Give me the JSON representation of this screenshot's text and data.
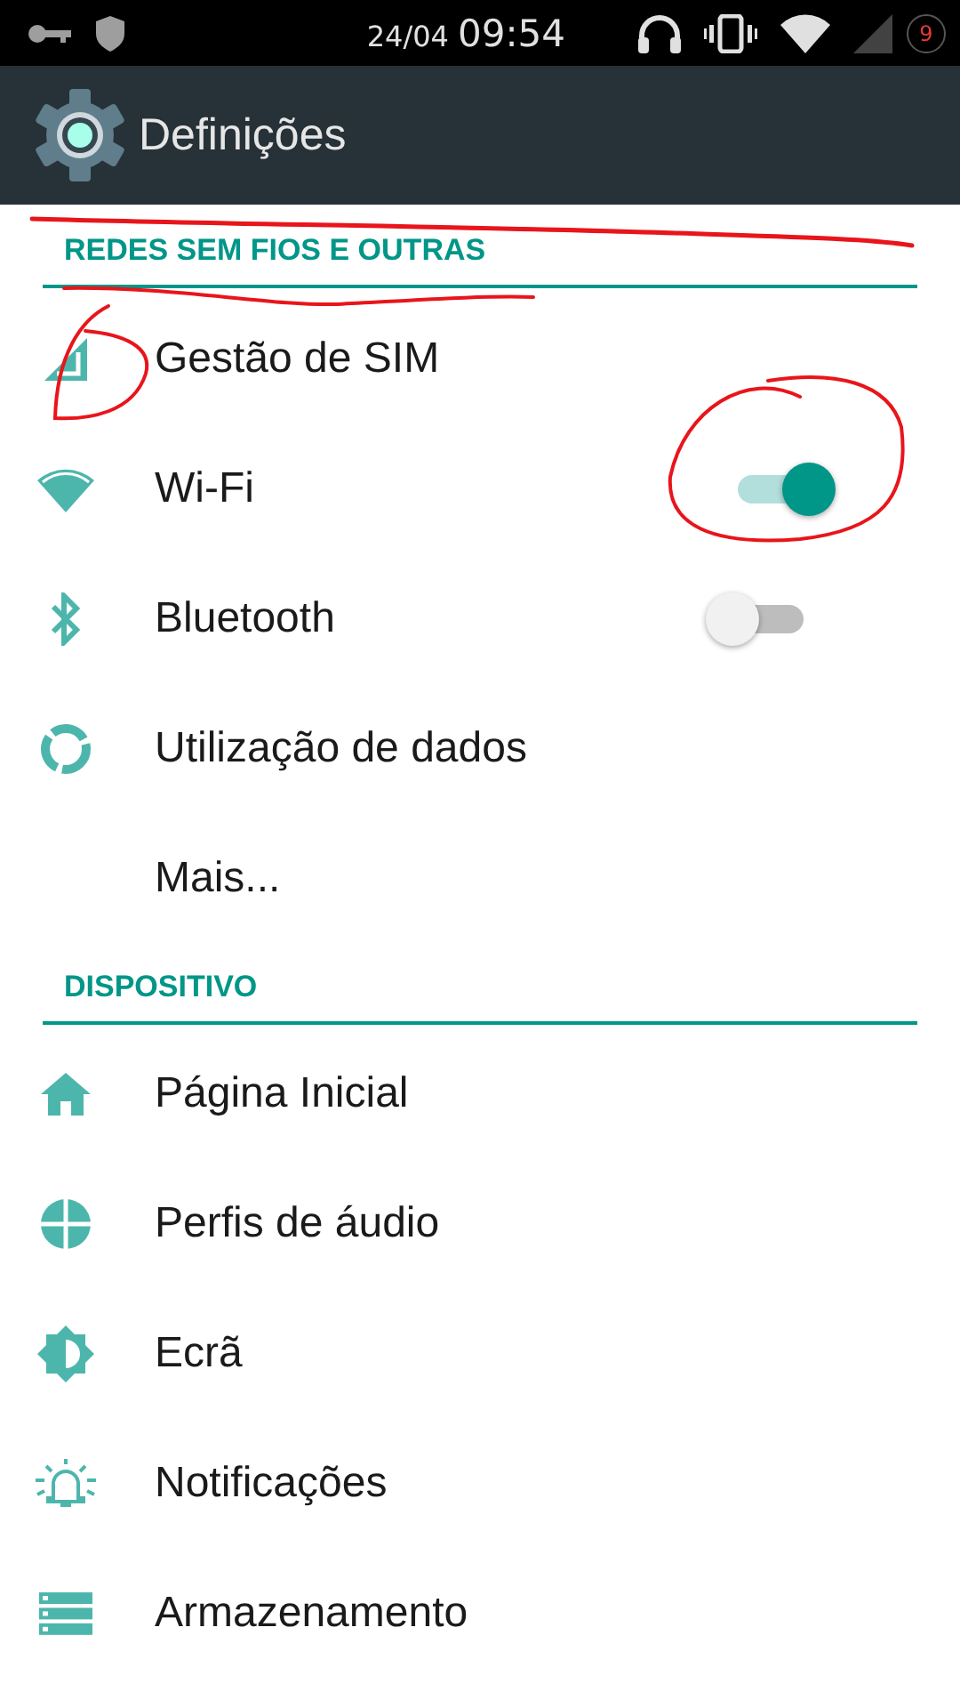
{
  "status_bar": {
    "date": "24/04",
    "time": "09:54",
    "badge": "9"
  },
  "app_bar": {
    "title": "Definições"
  },
  "sections": [
    {
      "title": "REDES SEM FIOS E OUTRAS",
      "items": [
        {
          "label": "Gestão de SIM",
          "kind": "plain"
        },
        {
          "label": "Wi-Fi",
          "kind": "switch",
          "on": true
        },
        {
          "label": "Bluetooth",
          "kind": "switch",
          "on": false
        },
        {
          "label": "Utilização de dados",
          "kind": "plain"
        },
        {
          "label": "Mais...",
          "kind": "plain"
        }
      ]
    },
    {
      "title": "DISPOSITIVO",
      "items": [
        {
          "label": "Página Inicial",
          "kind": "plain"
        },
        {
          "label": "Perfis de áudio",
          "kind": "plain"
        },
        {
          "label": "Ecrã",
          "kind": "plain"
        },
        {
          "label": "Notificações",
          "kind": "plain"
        },
        {
          "label": "Armazenamento",
          "kind": "plain"
        }
      ]
    }
  ]
}
